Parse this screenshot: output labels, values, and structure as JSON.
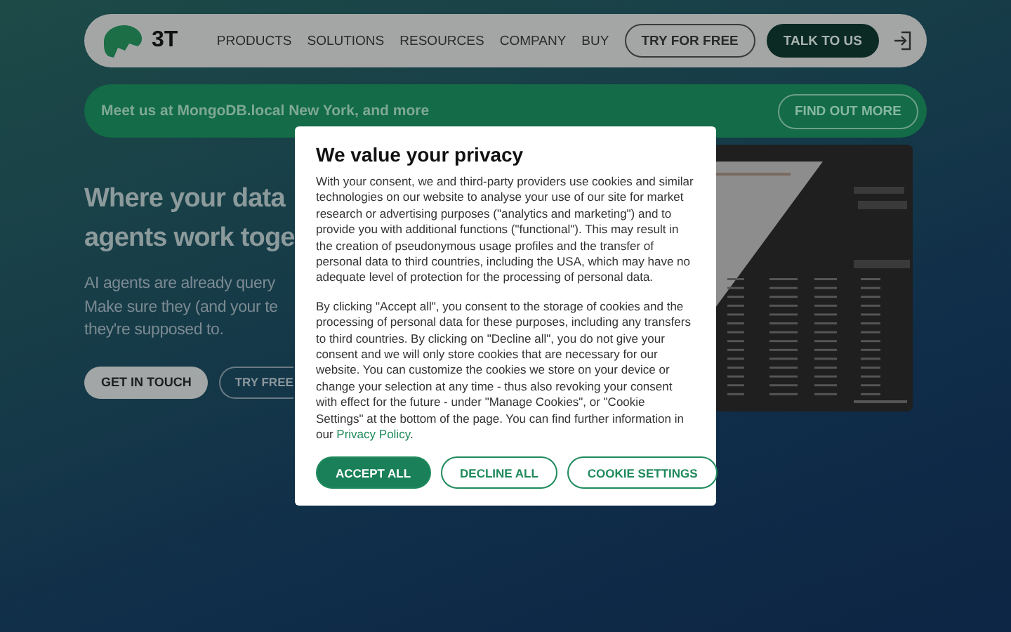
{
  "nav": {
    "logo": "3T",
    "items": [
      "PRODUCTS",
      "SOLUTIONS",
      "RESOURCES",
      "COMPANY",
      "BUY"
    ],
    "try_button": "TRY FOR FREE",
    "talk_button": "TALK TO US"
  },
  "banner": {
    "text": "Meet us at MongoDB.local New York, and more",
    "button": "FIND OUT MORE"
  },
  "hero": {
    "title_lines": [
      "Where your data",
      "agents work toge"
    ],
    "text_lines": [
      "AI agents are already query",
      "Make sure they (and your te",
      "they're supposed to."
    ],
    "primary_button": "GET IN TOUCH",
    "secondary_button": "TRY FREE"
  },
  "cookie_dialog": {
    "title": "We value your privacy",
    "paragraphs": [
      "With your consent, we and third-party providers use cookies and similar technologies on our website to analyse your use of our site for market research or advertising purposes (\"analytics and marketing\") and to provide you with additional functions (\"functional\"). This may result in the creation of pseudonymous usage profiles and the transfer of personal data to third countries, including the USA, which may have no adequate level of protection for the processing of personal data.",
      "By clicking \"Accept all\", you consent to the storage of cookies and the processing of personal data for these purposes, including any transfers to third countries. By clicking on \"Decline all\", you do not give your consent and we will only store cookies that are necessary for our website. You can customize the cookies we store on your device or change your selection at any time - thus also revoking your consent with effect for the future - under \"Manage Cookies\", or \"Cookie Settings\" at the bottom of the page. You can find further information in our"
    ],
    "link": "Privacy Policy",
    "link_suffix": ".",
    "buttons": [
      {
        "label": "ACCEPT ALL",
        "kind": "filled"
      },
      {
        "label": "DECLINE ALL",
        "kind": "outline"
      },
      {
        "label": "COOKIE SETTINGS",
        "kind": "outline"
      }
    ]
  }
}
